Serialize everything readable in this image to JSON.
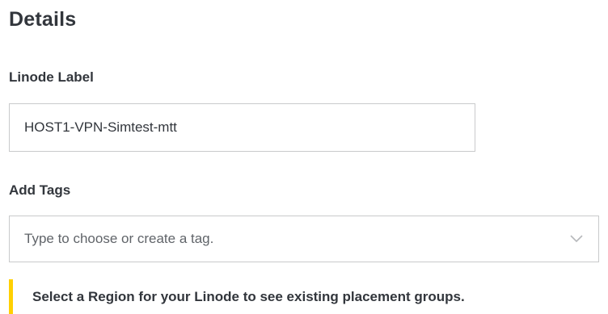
{
  "section": {
    "title": "Details"
  },
  "linode_label": {
    "label": "Linode Label",
    "value": "HOST1-VPN-Simtest-mtt"
  },
  "tags": {
    "label": "Add Tags",
    "placeholder": "Type to choose or create a tag.",
    "chevron_icon": "chevron-down-icon"
  },
  "placement_notice": {
    "text": "Select a Region for your Linode to see existing placement groups.",
    "accent_color": "#ffd002"
  }
}
